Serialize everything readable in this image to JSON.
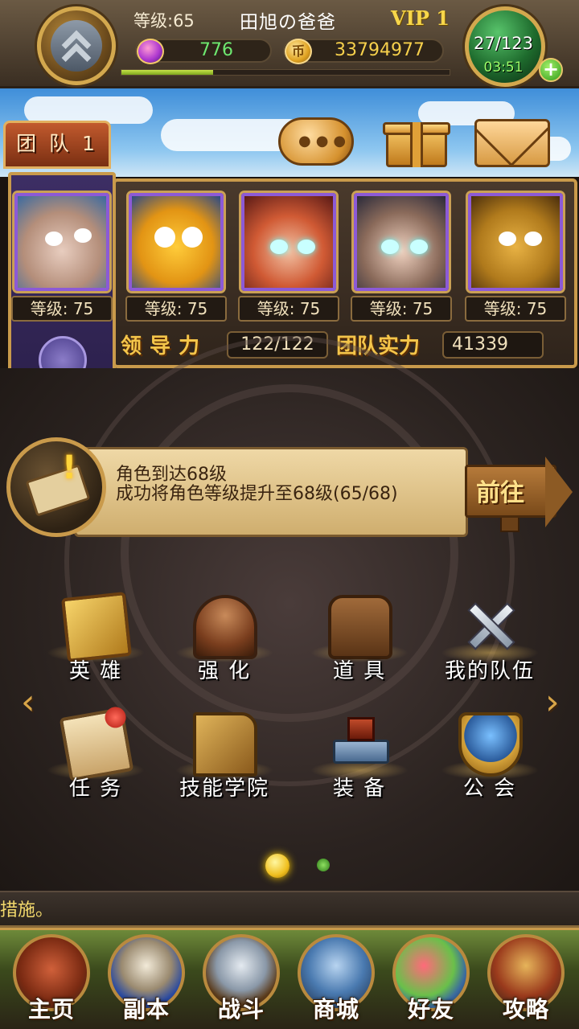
{
  "hud": {
    "level_label": "等级:65",
    "player_name": "田旭の爸爸",
    "vip": "VIP 1",
    "gems": "776",
    "coins": "33794977",
    "coin_glyph": "币",
    "energy": "27/123",
    "energy_timer": "03:51",
    "plus": "+",
    "exp_progress": 0.28
  },
  "top_buttons": {
    "team_tab": "团 队 1",
    "chat_dots": "●●●"
  },
  "heroes": [
    {
      "level": "等级: 75"
    },
    {
      "level": "等级: 75"
    },
    {
      "level": "等级: 75"
    },
    {
      "level": "等级: 75"
    },
    {
      "level": "等级: 75"
    }
  ],
  "stats": {
    "leadership_label": "领导力",
    "leadership_value": "122/122",
    "power_label": "团队实力",
    "power_value": "41339"
  },
  "quest": {
    "title": "角色到达68级",
    "description": "成功将角色等级提升至68级(65/68)",
    "bang": "!",
    "goto_label": "前往"
  },
  "menu": {
    "row1": [
      "英 雄",
      "强 化",
      "道 具",
      "我的队伍"
    ],
    "row2": [
      "任 务",
      "技能学院",
      "装 备",
      "公 会"
    ],
    "left_arrow": "‹",
    "right_arrow": "›"
  },
  "marquee": "措施。",
  "nav": [
    "主页",
    "副本",
    "战斗",
    "商城",
    "好友",
    "攻略"
  ],
  "colors": {
    "accent_gold": "#c99a4b",
    "gem_green": "#6ee870",
    "coin_yellow": "#f6d04c",
    "hero_frame_purple": "#8c5ad6"
  }
}
